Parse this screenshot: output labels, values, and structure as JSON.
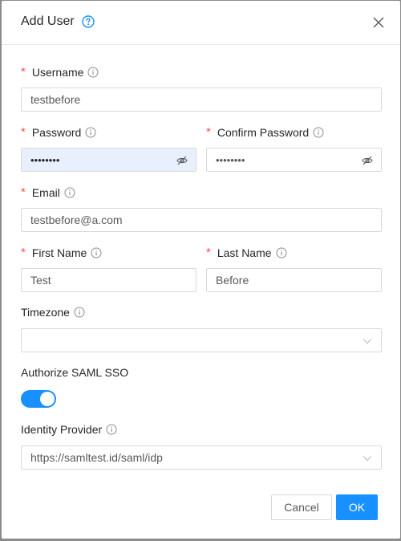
{
  "dialog": {
    "title": "Add User",
    "help_icon": "question-circle-icon",
    "close_icon": "close-icon"
  },
  "fields": {
    "username": {
      "label": "Username",
      "required": "*",
      "value": "testbefore"
    },
    "password": {
      "label": "Password",
      "required": "*",
      "value": "••••••••"
    },
    "confirm_password": {
      "label": "Confirm Password",
      "required": "*",
      "value": "••••••••"
    },
    "email": {
      "label": "Email",
      "required": "*",
      "value": "testbefore@a.com"
    },
    "first_name": {
      "label": "First Name",
      "required": "*",
      "value": "Test"
    },
    "last_name": {
      "label": "Last Name",
      "required": "*",
      "value": "Before"
    },
    "timezone": {
      "label": "Timezone",
      "value": ""
    },
    "saml_sso": {
      "label": "Authorize SAML SSO",
      "enabled": true
    },
    "identity_provider": {
      "label": "Identity Provider",
      "value": "https://samltest.id/saml/idp"
    }
  },
  "footer": {
    "cancel_label": "Cancel",
    "ok_label": "OK"
  },
  "colors": {
    "primary": "#1890ff",
    "required": "#ff4d4f",
    "autofill_bg": "#e8f0fe"
  }
}
